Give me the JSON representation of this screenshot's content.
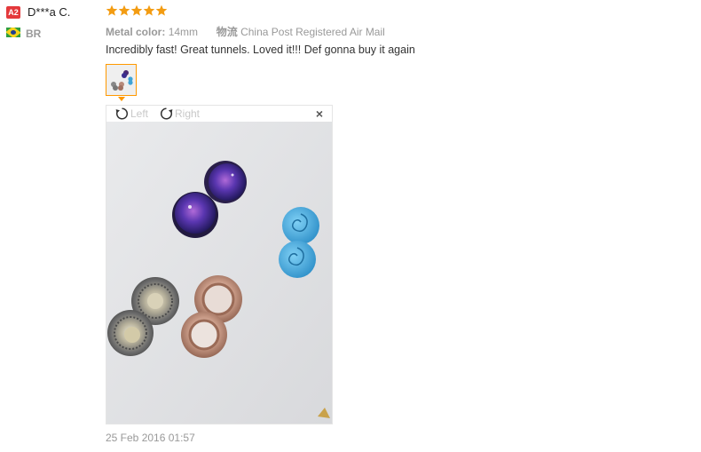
{
  "reviewer": {
    "level_badge": "A2",
    "name": "D***a C.",
    "country": "BR"
  },
  "rating": {
    "stars": 5,
    "max": 5,
    "color": "#f39c12"
  },
  "attributes": [
    {
      "key": "Metal color:",
      "value": "14mm"
    },
    {
      "key": "物流",
      "value": "China Post Registered Air Mail"
    }
  ],
  "review_text": "Incredibly fast! Great tunnels. Loved it!!! Def gonna buy it again",
  "viewer": {
    "rotate_left_label": "Left",
    "rotate_right_label": "Right",
    "close_label": "×"
  },
  "date": "25 Feb 2016 01:57",
  "colors": {
    "badge": "#e4393c",
    "thumb_border": "#ff9900"
  }
}
